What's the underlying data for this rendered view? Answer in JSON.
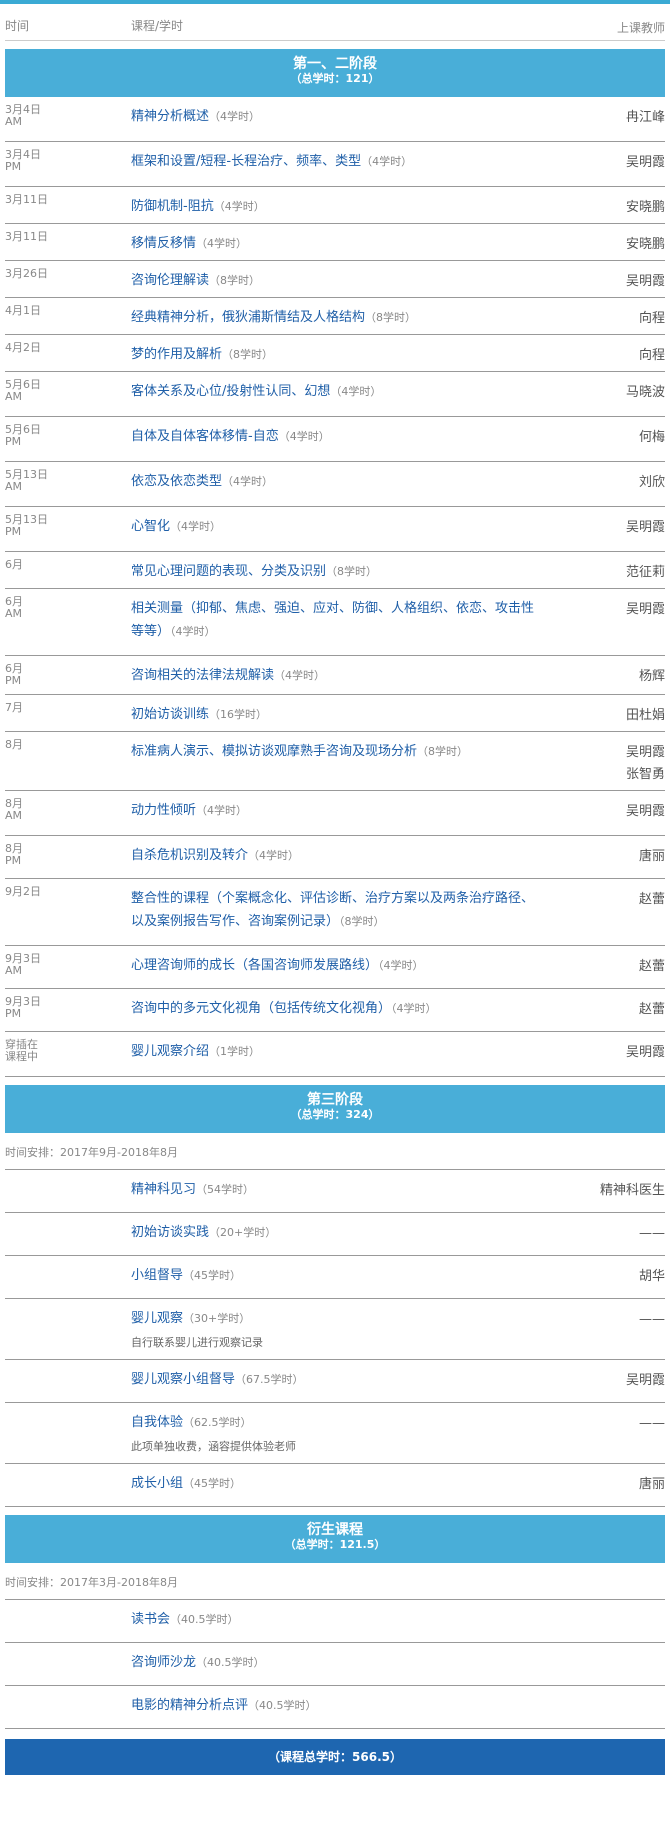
{
  "header": {
    "time": "时间",
    "course": "课程/学时",
    "teacher": "上课教师"
  },
  "stage1": {
    "title": "第一、二阶段",
    "subtitle": "（总学时：121）",
    "rows": [
      {
        "time": [
          "3月4日",
          "AM"
        ],
        "course": "精神分析概述",
        "hours": "（4学时）",
        "teacher": [
          "冉江峰"
        ]
      },
      {
        "time": [
          "3月4日",
          "PM"
        ],
        "course": "框架和设置/短程-长程治疗、频率、类型",
        "hours": "（4学时）",
        "teacher": [
          "吴明霞"
        ]
      },
      {
        "time": [
          "3月11日"
        ],
        "course": "防御机制-阻抗",
        "hours": "（4学时）",
        "teacher": [
          "安晓鹏"
        ]
      },
      {
        "time": [
          "3月11日"
        ],
        "course": "移情反移情",
        "hours": "（4学时）",
        "teacher": [
          "安晓鹏"
        ]
      },
      {
        "time": [
          "3月26日"
        ],
        "course": "咨询伦理解读",
        "hours": "（8学时）",
        "teacher": [
          "吴明霞"
        ]
      },
      {
        "time": [
          "4月1日"
        ],
        "course": "经典精神分析，俄狄浦斯情结及人格结构",
        "hours": "（8学时）",
        "teacher": [
          "向程"
        ]
      },
      {
        "time": [
          "4月2日"
        ],
        "course": "梦的作用及解析",
        "hours": "（8学时）",
        "teacher": [
          "向程"
        ]
      },
      {
        "time": [
          "5月6日",
          "AM"
        ],
        "course": "客体关系及心位/投射性认同、幻想",
        "hours": "（4学时）",
        "teacher": [
          "马晓波"
        ]
      },
      {
        "time": [
          "5月6日",
          "PM"
        ],
        "course": "自体及自体客体移情-自恋",
        "hours": "（4学时）",
        "teacher": [
          "何梅"
        ]
      },
      {
        "time": [
          "5月13日",
          "AM"
        ],
        "course": "依恋及依恋类型",
        "hours": "（4学时）",
        "teacher": [
          "刘欣"
        ]
      },
      {
        "time": [
          "5月13日",
          "PM"
        ],
        "course": "心智化",
        "hours": "（4学时）",
        "teacher": [
          "吴明霞"
        ]
      },
      {
        "time": [
          "6月"
        ],
        "course": "常见心理问题的表现、分类及识别",
        "hours": "（8学时）",
        "teacher": [
          "范征莉"
        ]
      },
      {
        "time": [
          "6月",
          "AM"
        ],
        "course": "相关测量（抑郁、焦虑、强迫、应对、防御、人格组织、依恋、攻击性等等）",
        "hours": "（4学时）",
        "teacher": [
          "吴明霞"
        ]
      },
      {
        "time": [
          "6月",
          "PM"
        ],
        "course": "咨询相关的法律法规解读",
        "hours": "（4学时）",
        "teacher": [
          "杨辉"
        ]
      },
      {
        "time": [
          "7月"
        ],
        "course": "初始访谈训练",
        "hours": "（16学时）",
        "teacher": [
          "田杜娟"
        ]
      },
      {
        "time": [
          "8月"
        ],
        "course": "标准病人演示、模拟访谈观摩熟手咨询及现场分析",
        "hours": "（8学时）",
        "teacher": [
          "吴明霞",
          "张智勇"
        ]
      },
      {
        "time": [
          "8月",
          "AM"
        ],
        "course": "动力性倾听",
        "hours": "（4学时）",
        "teacher": [
          "吴明霞"
        ]
      },
      {
        "time": [
          "8月",
          "PM"
        ],
        "course": "自杀危机识别及转介",
        "hours": "（4学时）",
        "teacher": [
          "唐丽"
        ]
      },
      {
        "time": [
          "9月2日"
        ],
        "course": "整合性的课程（个案概念化、评估诊断、治疗方案以及两条治疗路径、以及案例报告写作、咨询案例记录）",
        "hours": "（8学时）",
        "teacher": [
          "赵蕾"
        ]
      },
      {
        "time": [
          "9月3日",
          "AM"
        ],
        "course": "心理咨询师的成长（各国咨询师发展路线）",
        "hours": "（4学时）",
        "teacher": [
          "赵蕾"
        ]
      },
      {
        "time": [
          "9月3日",
          "PM"
        ],
        "course": "咨询中的多元文化视角（包括传统文化视角）",
        "hours": "（4学时）",
        "teacher": [
          "赵蕾"
        ]
      },
      {
        "time": [
          "穿插在",
          "课程中"
        ],
        "course": "婴儿观察介绍",
        "hours": "（1学时）",
        "teacher": [
          "吴明霞"
        ]
      }
    ]
  },
  "stage3": {
    "title": "第三阶段",
    "subtitle": "（总学时：324）",
    "note": "时间安排：2017年9月-2018年8月",
    "rows": [
      {
        "course": "精神科见习",
        "hours": "（54学时）",
        "teacher": [
          "精神科医生"
        ]
      },
      {
        "course": "初始访谈实践",
        "hours": "（20+学时）",
        "teacher": [
          "——"
        ]
      },
      {
        "course": "小组督导",
        "hours": "（45学时）",
        "teacher": [
          "胡华"
        ]
      },
      {
        "course": "婴儿观察",
        "hours": "（30+学时）",
        "sub": "自行联系婴儿进行观察记录",
        "teacher": [
          "——"
        ]
      },
      {
        "course": "婴儿观察小组督导",
        "hours": "（67.5学时）",
        "teacher": [
          "吴明霞"
        ]
      },
      {
        "course": "自我体验",
        "hours": "（62.5学时）",
        "sub": "此项单独收费，涵容提供体验老师",
        "teacher": [
          "——"
        ]
      },
      {
        "course": "成长小组",
        "hours": "（45学时）",
        "teacher": [
          "唐丽"
        ]
      }
    ]
  },
  "derived": {
    "title": "衍生课程",
    "subtitle": "（总学时：121.5）",
    "note": "时间安排：2017年3月-2018年8月",
    "rows": [
      {
        "course": "读书会",
        "hours": "（40.5学时）",
        "teacher": []
      },
      {
        "course": "咨询师沙龙",
        "hours": "（40.5学时）",
        "teacher": []
      },
      {
        "course": "电影的精神分析点评",
        "hours": "（40.5学时）",
        "teacher": []
      }
    ]
  },
  "total": "（课程总学时：566.5）",
  "colors": {
    "band": "#49aed8",
    "total_band": "#1e66b0",
    "link": "#1f5fa8",
    "top_bar": "#3aaad4"
  }
}
